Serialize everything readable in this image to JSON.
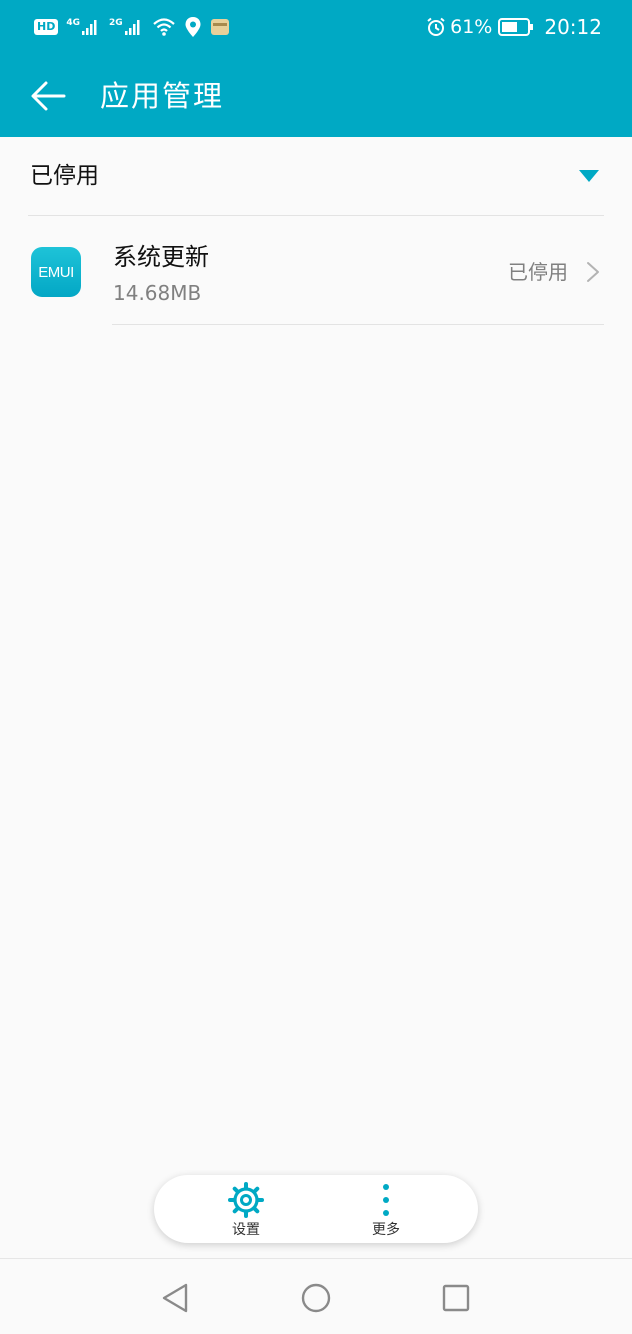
{
  "status_bar": {
    "hd_badge": "HD",
    "network_1": "4G",
    "network_2": "2G",
    "battery_percent": "61%",
    "time": "20:12",
    "icons": [
      "signal-icon",
      "wifi-icon",
      "location-icon",
      "wallet-icon",
      "alarm-icon",
      "battery-icon"
    ]
  },
  "app_bar": {
    "title": "应用管理",
    "back_icon": "arrow-left-icon"
  },
  "filter": {
    "selected": "已停用",
    "icon": "dropdown-triangle-icon"
  },
  "apps": [
    {
      "icon_text": "EMUI",
      "name": "系统更新",
      "size": "14.68MB",
      "status": "已停用"
    }
  ],
  "toolbar": {
    "settings_label": "设置",
    "more_label": "更多"
  },
  "colors": {
    "accent": "#00a9c4",
    "background": "#fafafa",
    "secondary_text": "#808080"
  }
}
